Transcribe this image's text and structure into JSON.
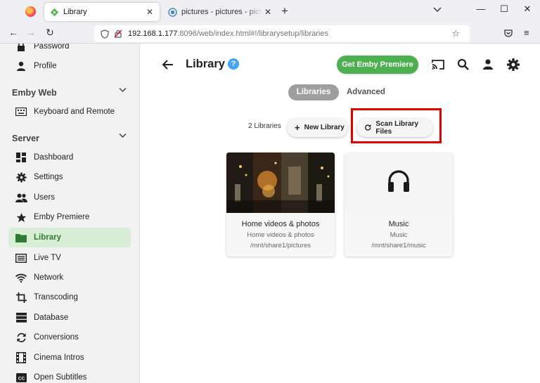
{
  "browser": {
    "tabs": [
      {
        "title": "Library",
        "active": true
      },
      {
        "title": "pictures - pictures - pictures - Emby",
        "active": false
      }
    ],
    "url_host": "192.168.1.177",
    "url_rest": ":8096/web/index.html#!/librarysetup/libraries"
  },
  "sidebar": {
    "items_top": [
      {
        "label": "Password",
        "icon": "lock-icon"
      },
      {
        "label": "Profile",
        "icon": "person-icon"
      }
    ],
    "section_emby_web": "Emby Web",
    "emby_web_items": [
      {
        "label": "Keyboard and Remote",
        "icon": "keyboard-icon"
      }
    ],
    "section_server": "Server",
    "server_items": [
      {
        "label": "Dashboard",
        "icon": "dashboard-icon"
      },
      {
        "label": "Settings",
        "icon": "gear-icon"
      },
      {
        "label": "Users",
        "icon": "people-icon"
      },
      {
        "label": "Emby Premiere",
        "icon": "star-icon"
      },
      {
        "label": "Library",
        "icon": "folder-icon",
        "active": true
      },
      {
        "label": "Live TV",
        "icon": "tv-guide-icon"
      },
      {
        "label": "Network",
        "icon": "wifi-icon"
      },
      {
        "label": "Transcoding",
        "icon": "crop-icon"
      },
      {
        "label": "Database",
        "icon": "database-icon"
      },
      {
        "label": "Conversions",
        "icon": "sync-icon"
      },
      {
        "label": "Cinema Intros",
        "icon": "film-icon"
      },
      {
        "label": "Open Subtitles",
        "icon": "cc-icon"
      }
    ]
  },
  "header": {
    "title": "Library",
    "premiere_button": "Get Emby Premiere"
  },
  "tabs": {
    "libraries": "Libraries",
    "advanced": "Advanced"
  },
  "toolbar": {
    "count": "2 Libraries",
    "new_library": "New Library",
    "scan_library": "Scan Library Files"
  },
  "libraries": [
    {
      "name": "Home videos & photos",
      "type": "Home videos & photos",
      "path": "/mnt/share1/pictures",
      "image": "photo-thumbnail"
    },
    {
      "name": "Music",
      "type": "Music",
      "path": "/mnt/share1/music",
      "image": "headphones-icon"
    }
  ],
  "colors": {
    "accent_green": "#4caf50",
    "active_nav_bg": "#d8eed6",
    "highlight_red": "#e00000",
    "help_blue": "#42a5f5"
  }
}
